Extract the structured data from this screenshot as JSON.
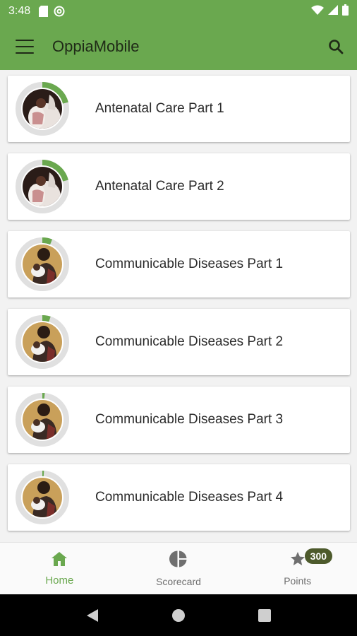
{
  "status_bar": {
    "time": "3:48",
    "icons": [
      "sd-card-icon",
      "sync-icon",
      "wifi-icon",
      "signal-icon",
      "battery-icon"
    ]
  },
  "app_bar": {
    "title": "OppiaMobile",
    "menu_icon": "hamburger-menu-icon",
    "search_icon": "search-icon"
  },
  "courses": [
    {
      "title": "Antenatal Care Part 1",
      "progress": 0.21,
      "image": "mother-and-child"
    },
    {
      "title": "Antenatal Care Part 2",
      "progress": 0.21,
      "image": "mother-and-child"
    },
    {
      "title": "Communicable Diseases Part 1",
      "progress": 0.06,
      "image": "mother-holding-baby"
    },
    {
      "title": "Communicable Diseases Part 2",
      "progress": 0.05,
      "image": "mother-holding-baby"
    },
    {
      "title": "Communicable Diseases Part 3",
      "progress": 0.015,
      "image": "mother-holding-baby"
    },
    {
      "title": "Communicable Diseases Part 4",
      "progress": 0.01,
      "image": "mother-holding-baby"
    }
  ],
  "bottom_nav": {
    "home": {
      "label": "Home",
      "icon": "home-icon"
    },
    "scorecard": {
      "label": "Scorecard",
      "icon": "pie-chart-icon"
    },
    "points": {
      "label": "Points",
      "icon": "star-icon",
      "badge": "300"
    }
  },
  "colors": {
    "primary": "#6aa84f",
    "ring_track": "#e0e0e0",
    "badge": "#4d5a2c"
  }
}
